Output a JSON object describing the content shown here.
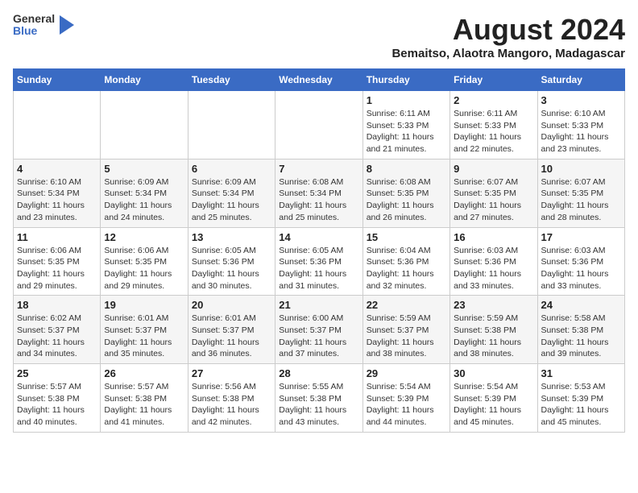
{
  "header": {
    "logo": {
      "line1": "General",
      "line2": "Blue"
    },
    "title": "August 2024",
    "subtitle": "Bemaitso, Alaotra Mangoro, Madagascar"
  },
  "calendar": {
    "weekdays": [
      "Sunday",
      "Monday",
      "Tuesday",
      "Wednesday",
      "Thursday",
      "Friday",
      "Saturday"
    ],
    "weeks": [
      [
        {
          "day": "",
          "info": ""
        },
        {
          "day": "",
          "info": ""
        },
        {
          "day": "",
          "info": ""
        },
        {
          "day": "",
          "info": ""
        },
        {
          "day": "1",
          "info": "Sunrise: 6:11 AM\nSunset: 5:33 PM\nDaylight: 11 hours\nand 21 minutes."
        },
        {
          "day": "2",
          "info": "Sunrise: 6:11 AM\nSunset: 5:33 PM\nDaylight: 11 hours\nand 22 minutes."
        },
        {
          "day": "3",
          "info": "Sunrise: 6:10 AM\nSunset: 5:33 PM\nDaylight: 11 hours\nand 23 minutes."
        }
      ],
      [
        {
          "day": "4",
          "info": "Sunrise: 6:10 AM\nSunset: 5:34 PM\nDaylight: 11 hours\nand 23 minutes."
        },
        {
          "day": "5",
          "info": "Sunrise: 6:09 AM\nSunset: 5:34 PM\nDaylight: 11 hours\nand 24 minutes."
        },
        {
          "day": "6",
          "info": "Sunrise: 6:09 AM\nSunset: 5:34 PM\nDaylight: 11 hours\nand 25 minutes."
        },
        {
          "day": "7",
          "info": "Sunrise: 6:08 AM\nSunset: 5:34 PM\nDaylight: 11 hours\nand 25 minutes."
        },
        {
          "day": "8",
          "info": "Sunrise: 6:08 AM\nSunset: 5:35 PM\nDaylight: 11 hours\nand 26 minutes."
        },
        {
          "day": "9",
          "info": "Sunrise: 6:07 AM\nSunset: 5:35 PM\nDaylight: 11 hours\nand 27 minutes."
        },
        {
          "day": "10",
          "info": "Sunrise: 6:07 AM\nSunset: 5:35 PM\nDaylight: 11 hours\nand 28 minutes."
        }
      ],
      [
        {
          "day": "11",
          "info": "Sunrise: 6:06 AM\nSunset: 5:35 PM\nDaylight: 11 hours\nand 29 minutes."
        },
        {
          "day": "12",
          "info": "Sunrise: 6:06 AM\nSunset: 5:35 PM\nDaylight: 11 hours\nand 29 minutes."
        },
        {
          "day": "13",
          "info": "Sunrise: 6:05 AM\nSunset: 5:36 PM\nDaylight: 11 hours\nand 30 minutes."
        },
        {
          "day": "14",
          "info": "Sunrise: 6:05 AM\nSunset: 5:36 PM\nDaylight: 11 hours\nand 31 minutes."
        },
        {
          "day": "15",
          "info": "Sunrise: 6:04 AM\nSunset: 5:36 PM\nDaylight: 11 hours\nand 32 minutes."
        },
        {
          "day": "16",
          "info": "Sunrise: 6:03 AM\nSunset: 5:36 PM\nDaylight: 11 hours\nand 33 minutes."
        },
        {
          "day": "17",
          "info": "Sunrise: 6:03 AM\nSunset: 5:36 PM\nDaylight: 11 hours\nand 33 minutes."
        }
      ],
      [
        {
          "day": "18",
          "info": "Sunrise: 6:02 AM\nSunset: 5:37 PM\nDaylight: 11 hours\nand 34 minutes."
        },
        {
          "day": "19",
          "info": "Sunrise: 6:01 AM\nSunset: 5:37 PM\nDaylight: 11 hours\nand 35 minutes."
        },
        {
          "day": "20",
          "info": "Sunrise: 6:01 AM\nSunset: 5:37 PM\nDaylight: 11 hours\nand 36 minutes."
        },
        {
          "day": "21",
          "info": "Sunrise: 6:00 AM\nSunset: 5:37 PM\nDaylight: 11 hours\nand 37 minutes."
        },
        {
          "day": "22",
          "info": "Sunrise: 5:59 AM\nSunset: 5:37 PM\nDaylight: 11 hours\nand 38 minutes."
        },
        {
          "day": "23",
          "info": "Sunrise: 5:59 AM\nSunset: 5:38 PM\nDaylight: 11 hours\nand 38 minutes."
        },
        {
          "day": "24",
          "info": "Sunrise: 5:58 AM\nSunset: 5:38 PM\nDaylight: 11 hours\nand 39 minutes."
        }
      ],
      [
        {
          "day": "25",
          "info": "Sunrise: 5:57 AM\nSunset: 5:38 PM\nDaylight: 11 hours\nand 40 minutes."
        },
        {
          "day": "26",
          "info": "Sunrise: 5:57 AM\nSunset: 5:38 PM\nDaylight: 11 hours\nand 41 minutes."
        },
        {
          "day": "27",
          "info": "Sunrise: 5:56 AM\nSunset: 5:38 PM\nDaylight: 11 hours\nand 42 minutes."
        },
        {
          "day": "28",
          "info": "Sunrise: 5:55 AM\nSunset: 5:38 PM\nDaylight: 11 hours\nand 43 minutes."
        },
        {
          "day": "29",
          "info": "Sunrise: 5:54 AM\nSunset: 5:39 PM\nDaylight: 11 hours\nand 44 minutes."
        },
        {
          "day": "30",
          "info": "Sunrise: 5:54 AM\nSunset: 5:39 PM\nDaylight: 11 hours\nand 45 minutes."
        },
        {
          "day": "31",
          "info": "Sunrise: 5:53 AM\nSunset: 5:39 PM\nDaylight: 11 hours\nand 45 minutes."
        }
      ]
    ]
  }
}
